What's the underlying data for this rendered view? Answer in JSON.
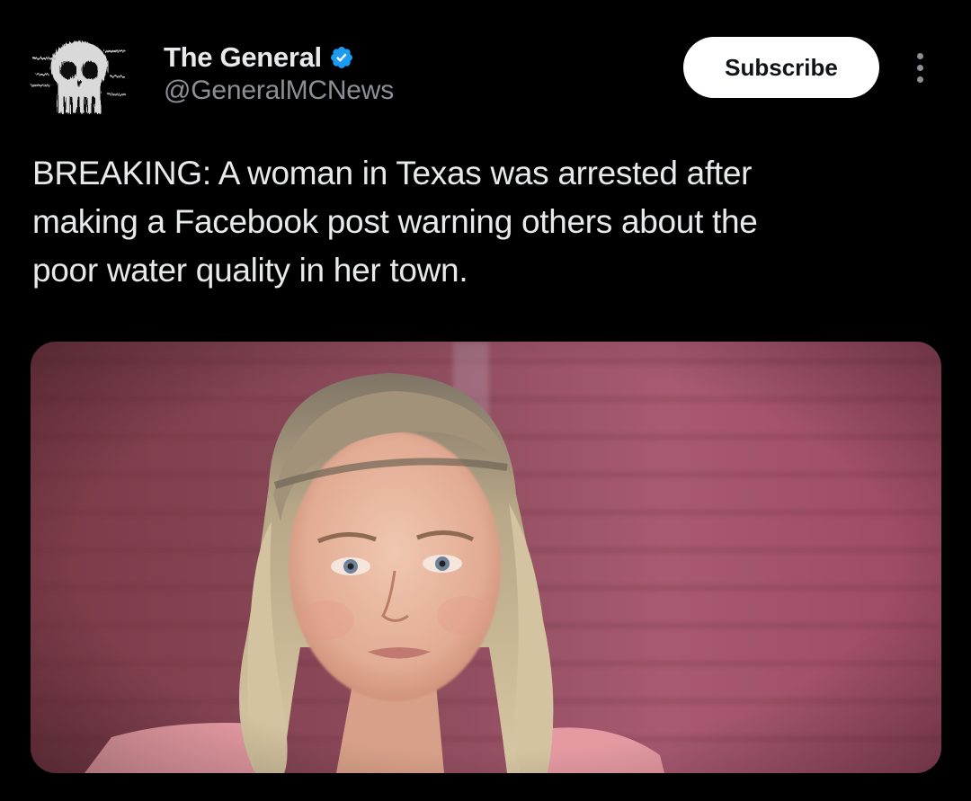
{
  "post": {
    "author": {
      "display_name": "The General",
      "handle": "@GeneralMCNews",
      "verified_icon": "verified-badge-icon",
      "avatar_icon": "skull-logo-icon"
    },
    "subscribe_label": "Subscribe",
    "more_icon": "more-vertical-icon",
    "text_lines": [
      "BREAKING: A woman in Texas was arrested after",
      "making a Facebook post warning others about the",
      "poor water quality in her town."
    ],
    "media": {
      "type": "photo",
      "subject": "woman-portrait"
    }
  },
  "colors": {
    "background": "#000000",
    "primary_text": "#e7e9ea",
    "secondary_text": "#8b9096",
    "verified_blue": "#1d9bf0",
    "button_bg": "#ffffff",
    "button_text": "#0f1419"
  }
}
